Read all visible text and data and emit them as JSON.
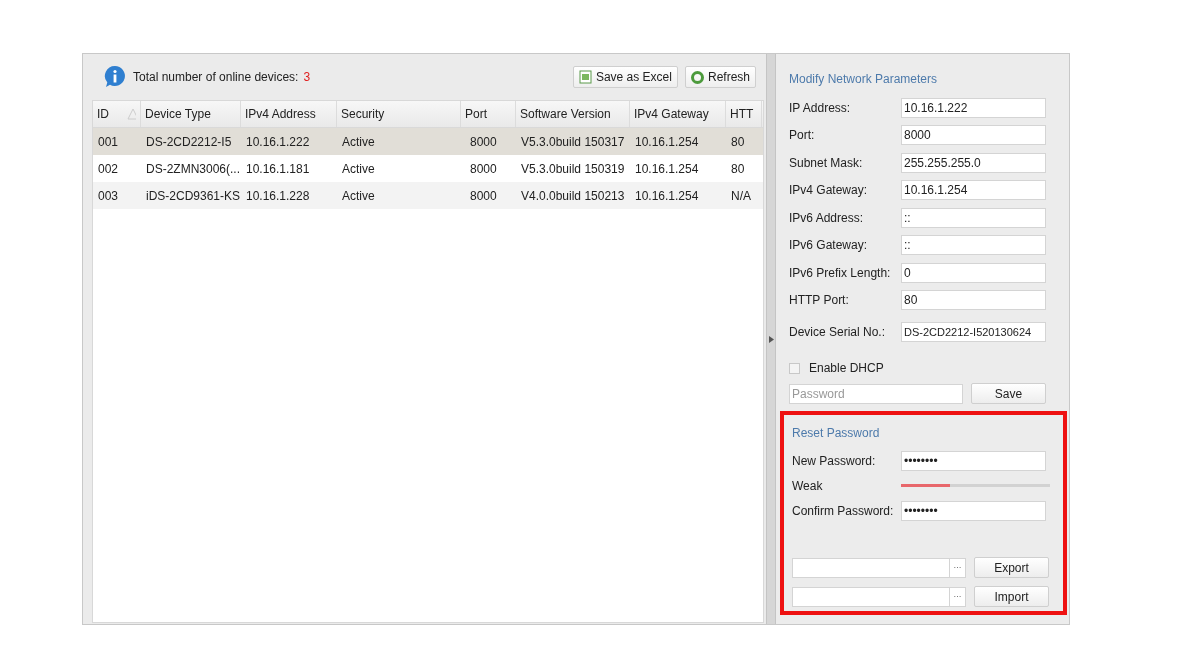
{
  "summary": {
    "label": "Total number of online devices:",
    "count": "3"
  },
  "toolbar": [
    "Save as Excel",
    "Refresh"
  ],
  "table": {
    "columns": [
      "ID",
      "Device Type",
      "IPv4 Address",
      "Security",
      "Port",
      "Software Version",
      "IPv4 Gateway",
      "HTT"
    ],
    "rows": [
      {
        "selected": true,
        "cells": [
          "001",
          "DS-2CD2212-I5",
          "10.16.1.222",
          "Active",
          "8000",
          "V5.3.0build 150317",
          "10.16.1.254",
          "80"
        ]
      },
      {
        "selected": false,
        "cells": [
          "002",
          "DS-2ZMN3006(...",
          "10.16.1.181",
          "Active",
          "8000",
          "V5.3.0build 150319",
          "10.16.1.254",
          "80"
        ]
      },
      {
        "selected": false,
        "cells": [
          "003",
          "iDS-2CD9361-KS",
          "10.16.1.228",
          "Active",
          "8000",
          "V4.0.0build 150213",
          "10.16.1.254",
          "N/A"
        ]
      }
    ]
  },
  "network": {
    "title": "Modify Network Parameters",
    "fields": [
      {
        "label": "IP Address:",
        "value": "10.16.1.222"
      },
      {
        "label": "Port:",
        "value": "8000"
      },
      {
        "label": "Subnet Mask:",
        "value": "255.255.255.0"
      },
      {
        "label": "IPv4 Gateway:",
        "value": "10.16.1.254"
      },
      {
        "label": "IPv6 Address:",
        "value": "::"
      },
      {
        "label": "IPv6 Gateway:",
        "value": "::"
      },
      {
        "label": "IPv6 Prefix Length:",
        "value": "0"
      },
      {
        "label": "HTTP Port:",
        "value": "80"
      },
      {
        "label": "Device Serial No.:",
        "value": "DS-2CD2212-I520130624"
      }
    ],
    "dhcp": {
      "label": "Enable DHCP",
      "checked": false
    },
    "password": {
      "placeholder": "Password"
    },
    "save": "Save"
  },
  "reset": {
    "title": "Reset Password",
    "new_password": {
      "label": "New Password:",
      "value": "••••••••"
    },
    "strength": {
      "label": "Weak",
      "level": 0.33
    },
    "confirm_password": {
      "label": "Confirm Password:",
      "value": "••••••••"
    },
    "files": [
      {
        "browse": "···",
        "button": "Export"
      },
      {
        "browse": "···",
        "button": "Import"
      }
    ]
  }
}
